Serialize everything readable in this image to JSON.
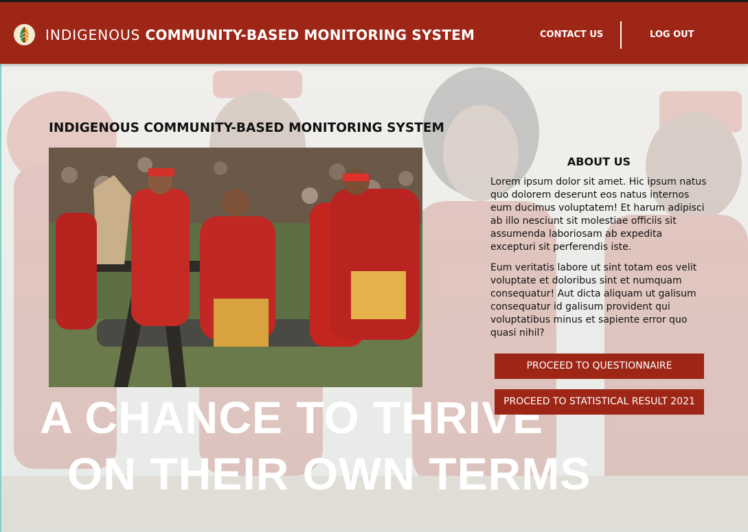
{
  "header": {
    "brand_prefix": "INDIGENOUS",
    "brand_suffix": "COMMUNITY-BASED MONITORING SYSTEM",
    "contact_label": "CONTACT US",
    "logout_label": "LOG OUT",
    "logo_icon": "leaf-logo-icon",
    "bar_color": "#9e2617"
  },
  "main": {
    "page_title": "INDIGENOUS COMMUNITY-BASED MONITORING SYSTEM",
    "photo_icon": "indigenous-dancers-photo",
    "about": {
      "title": "ABOUT US",
      "paragraph1": "Lorem ipsum dolor sit amet. Hic ipsum natus quo dolorem deserunt eos natus internos eum ducimus voluptatem! Et harum adipisci ab illo nesciunt sit molestiae officiis sit assumenda laboriosam ab expedita excepturi sit perferendis iste.",
      "paragraph2": "Eum veritatis labore ut sint totam eos velit voluptate et doloribus sint et numquam consequatur! Aut dicta aliquam ut galisum consequatur id galisum provident qui voluptatibus minus et sapiente error quo quasi nihil?"
    },
    "buttons": {
      "questionnaire_label": "PROCEED TO QUESTIONNAIRE",
      "statistics_label": "PROCEED TO STATISTICAL RESULT 2021"
    }
  },
  "background": {
    "slogan_line1": "A CHANCE TO THRIVE",
    "slogan_line2": "ON THEIR OWN TERMS"
  }
}
